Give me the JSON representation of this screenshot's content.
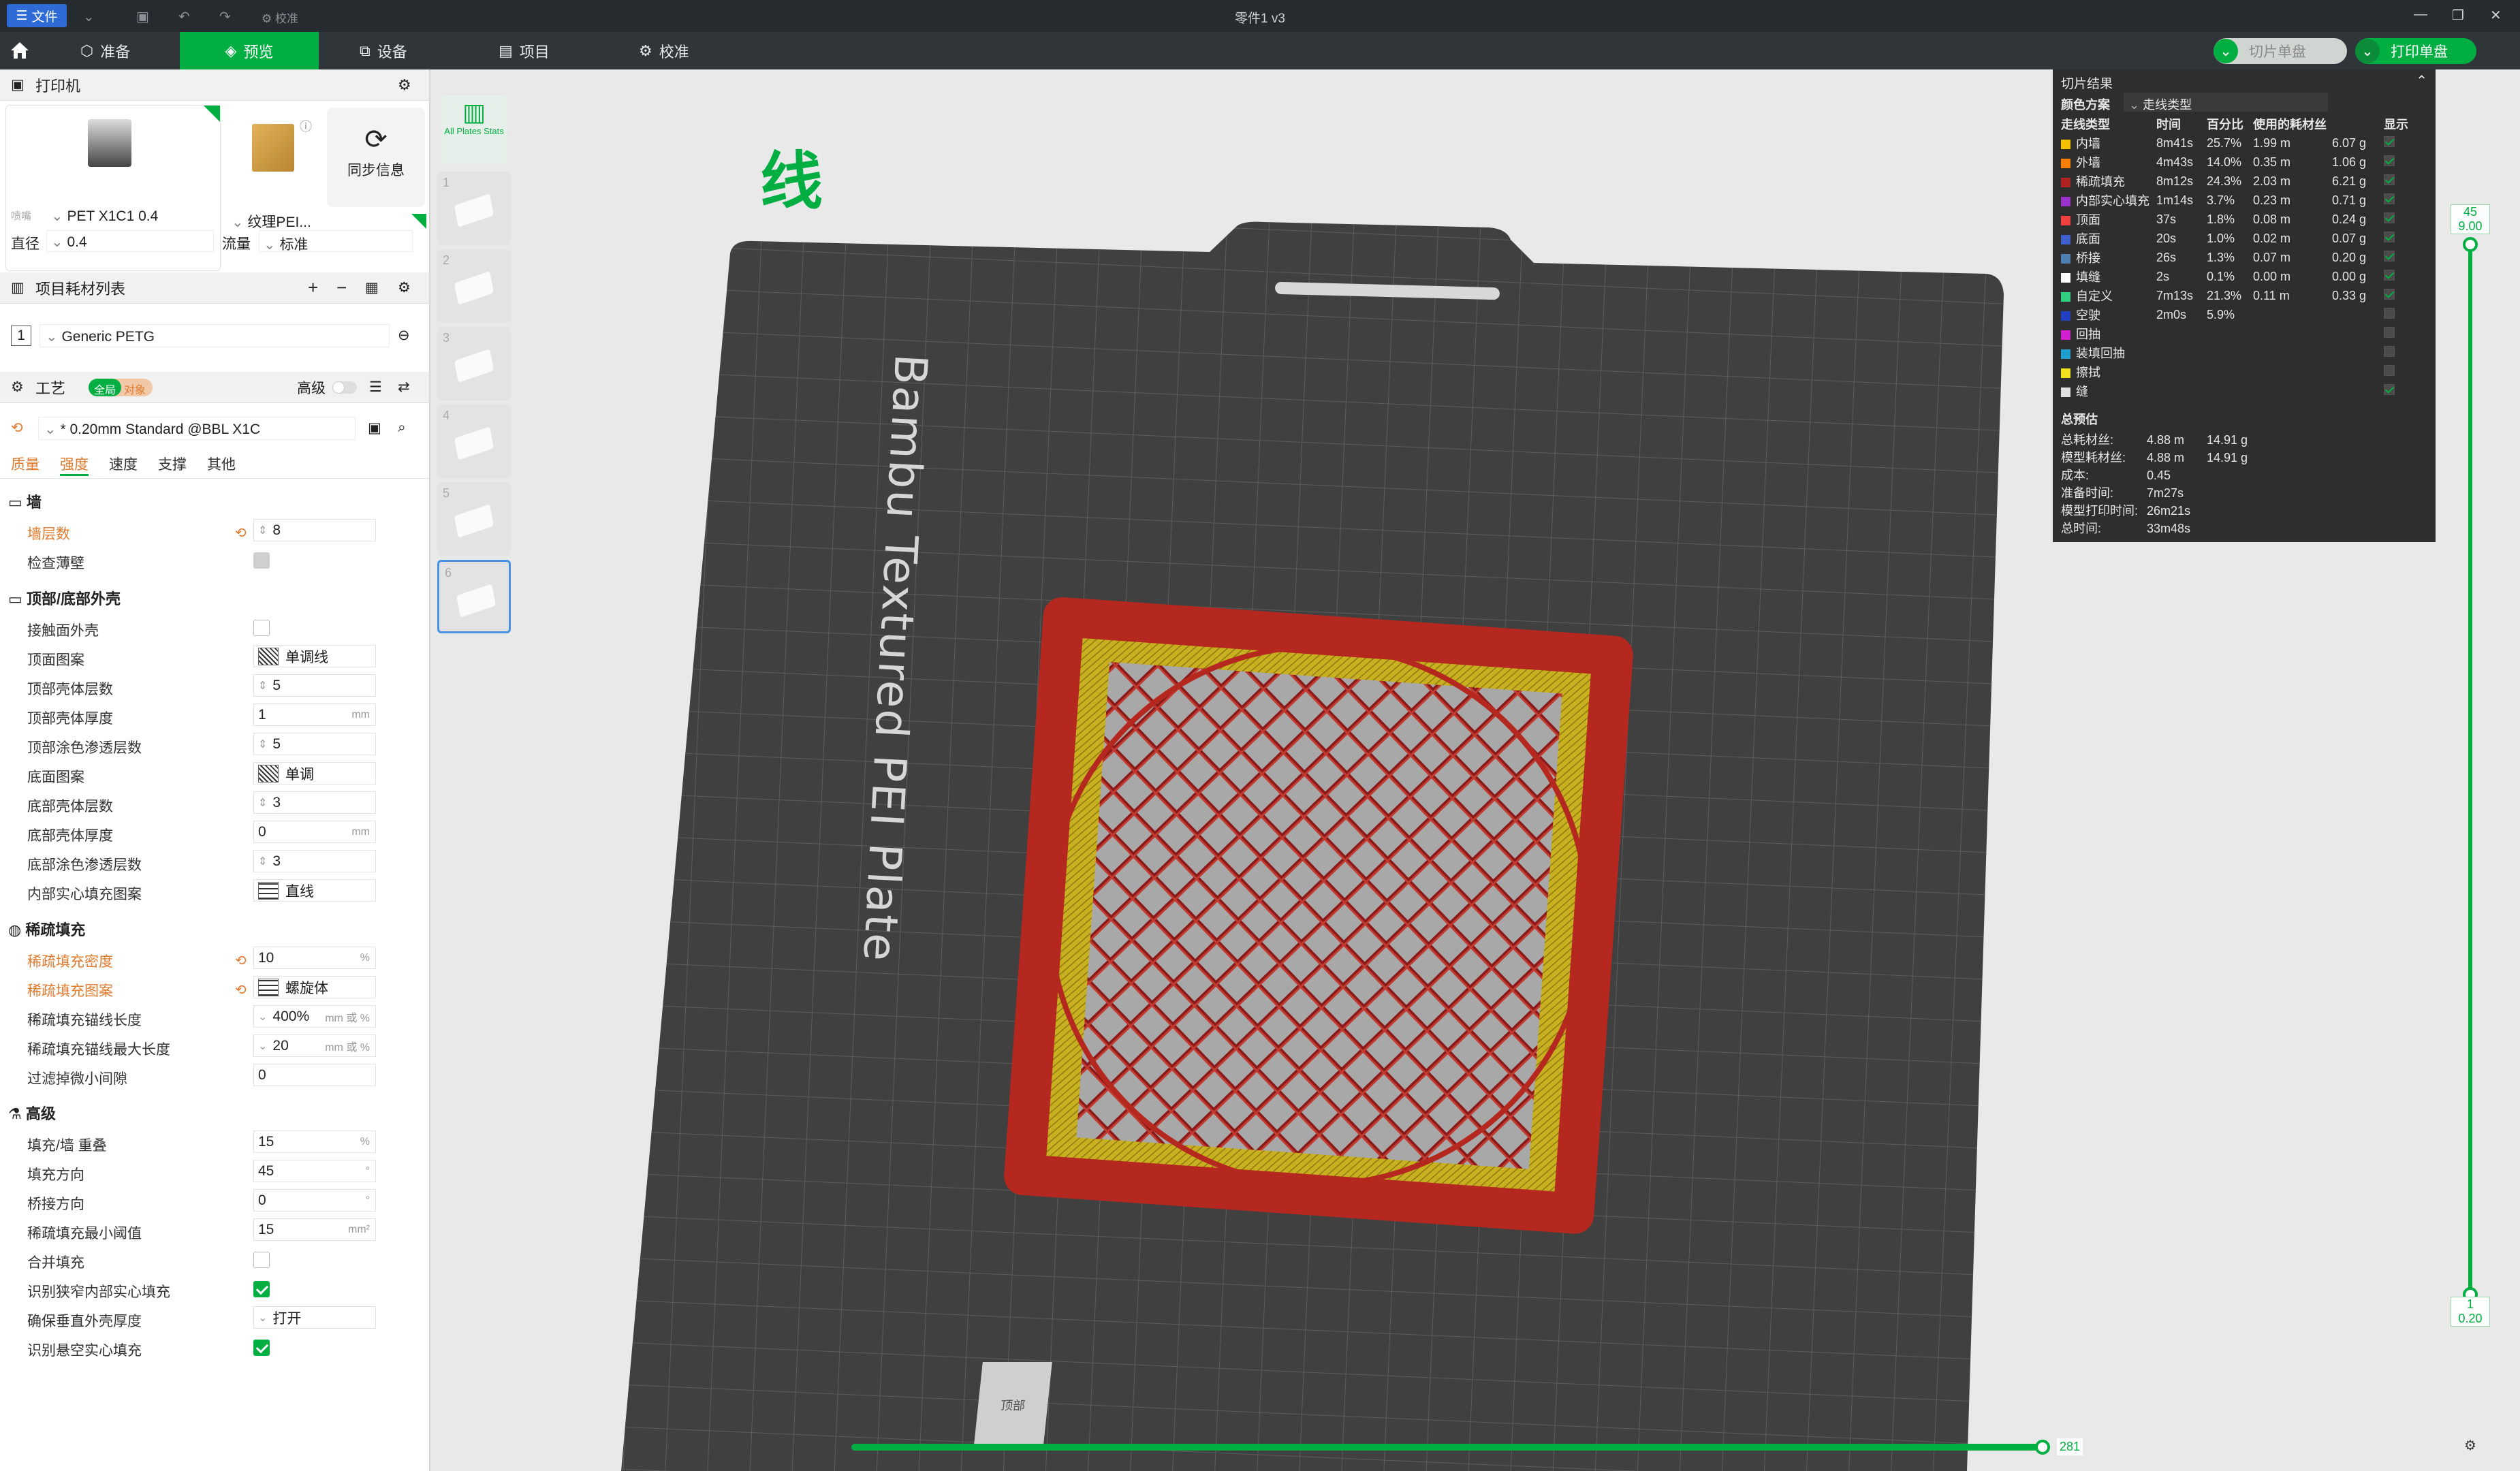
{
  "titlebar": {
    "file_menu": "文件",
    "verify": "校准",
    "title": "零件1 v3"
  },
  "tabs": [
    {
      "label": "准备"
    },
    {
      "label": "预览"
    },
    {
      "label": "设备"
    },
    {
      "label": "项目"
    },
    {
      "label": "校准"
    }
  ],
  "toolbar": {
    "slice_label": "切片单盘",
    "print_label": "打印单盘"
  },
  "printer": {
    "section": "打印机",
    "name": "PET X1C1 0.4",
    "plate": "纹理PEI...",
    "sync": "同步信息",
    "nozzle_group": "喷嘴",
    "diameter_label": "直径",
    "diameter": "0.4",
    "flow_label": "流量",
    "flow": "标准"
  },
  "filament": {
    "section": "项目耗材列表",
    "index": "1",
    "name": "Generic PETG"
  },
  "process": {
    "section": "工艺",
    "toggle_global": "全局",
    "toggle_object": "对象",
    "advanced": "高级",
    "preset": "* 0.20mm Standard @BBL X1C",
    "tabs": [
      "质量",
      "强度",
      "速度",
      "支撑",
      "其他"
    ]
  },
  "groups": {
    "wall": "墙",
    "topbottom": "顶部/底部外壳",
    "infill": "稀疏填充",
    "advanced": "高级"
  },
  "settings": {
    "wall_loops": {
      "label": "墙层数",
      "value": "8"
    },
    "detect_thin": {
      "label": "检查薄壁"
    },
    "interface_shells": {
      "label": "接触面外壳"
    },
    "top_pattern": {
      "label": "顶面图案",
      "value": "单调线"
    },
    "top_layers": {
      "label": "顶部壳体层数",
      "value": "5"
    },
    "top_thickness": {
      "label": "顶部壳体厚度",
      "value": "1",
      "unit": "mm"
    },
    "top_paint": {
      "label": "顶部涂色渗透层数",
      "value": "5"
    },
    "bottom_pattern": {
      "label": "底面图案",
      "value": "单调"
    },
    "bottom_layers": {
      "label": "底部壳体层数",
      "value": "3"
    },
    "bottom_thickness": {
      "label": "底部壳体厚度",
      "value": "0",
      "unit": "mm"
    },
    "bottom_paint": {
      "label": "底部涂色渗透层数",
      "value": "3"
    },
    "internal_pattern": {
      "label": "内部实心填充图案",
      "value": "直线"
    },
    "infill_density": {
      "label": "稀疏填充密度",
      "value": "10",
      "unit": "%"
    },
    "infill_pattern": {
      "label": "稀疏填充图案",
      "value": "螺旋体"
    },
    "anchor_len": {
      "label": "稀疏填充锚线长度",
      "value": "400%",
      "unit": "mm 或 %"
    },
    "anchor_max": {
      "label": "稀疏填充锚线最大长度",
      "value": "20",
      "unit": "mm 或 %"
    },
    "filter_gap": {
      "label": "过滤掉微小间隙",
      "value": "0"
    },
    "overlap": {
      "label": "填充/墙 重叠",
      "value": "15",
      "unit": "%"
    },
    "infill_dir": {
      "label": "填充方向",
      "value": "45",
      "unit": "°"
    },
    "bridge_dir": {
      "label": "桥接方向",
      "value": "0",
      "unit": "°"
    },
    "min_area": {
      "label": "稀疏填充最小阈值",
      "value": "15",
      "unit": "mm²"
    },
    "combine": {
      "label": "合并填充"
    },
    "detect_narrow": {
      "label": "识别狭窄内部实心填充"
    },
    "ensure_vertical": {
      "label": "确保垂直外壳厚度",
      "value": "打开"
    },
    "overhang_solid": {
      "label": "识别悬空实心填充"
    }
  },
  "plates": {
    "all_label": "All Plates Stats",
    "items": [
      "1",
      "2",
      "3",
      "4",
      "5",
      "6"
    ]
  },
  "viewport": {
    "legend_title": "线",
    "bed_text": "Bambu Textured PEI Plate",
    "view_cube": "顶部",
    "vslider": {
      "top_layer": "45",
      "top_height": "9.00",
      "bottom_layer": "1",
      "bottom_height": "0.20"
    },
    "hslider_value": "281"
  },
  "result": {
    "title": "切片结果",
    "scheme_label": "颜色方案",
    "scheme": "走线类型",
    "headers": [
      "走线类型",
      "时间",
      "百分比",
      "使用的耗材丝",
      "",
      "显示"
    ],
    "rows": [
      {
        "name": "内墙",
        "color": "#f5c000",
        "time": "8m41s",
        "pct": "25.7%",
        "len": "1.99 m",
        "g": "6.07 g",
        "show": true
      },
      {
        "name": "外墙",
        "color": "#ff8000",
        "time": "4m43s",
        "pct": "14.0%",
        "len": "0.35 m",
        "g": "1.06 g",
        "show": true
      },
      {
        "name": "稀疏填充",
        "color": "#b22222",
        "time": "8m12s",
        "pct": "24.3%",
        "len": "2.03 m",
        "g": "6.21 g",
        "show": true
      },
      {
        "name": "内部实心填充",
        "color": "#9933cc",
        "time": "1m14s",
        "pct": "3.7%",
        "len": "0.23 m",
        "g": "0.71 g",
        "show": true
      },
      {
        "name": "顶面",
        "color": "#f04040",
        "time": "37s",
        "pct": "1.8%",
        "len": "0.08 m",
        "g": "0.24 g",
        "show": true
      },
      {
        "name": "底面",
        "color": "#4060d0",
        "time": "20s",
        "pct": "1.0%",
        "len": "0.02 m",
        "g": "0.07 g",
        "show": true
      },
      {
        "name": "桥接",
        "color": "#5080b0",
        "time": "26s",
        "pct": "1.3%",
        "len": "0.07 m",
        "g": "0.20 g",
        "show": true
      },
      {
        "name": "填缝",
        "color": "#ffffff",
        "time": "2s",
        "pct": "0.1%",
        "len": "0.00 m",
        "g": "0.00 g",
        "show": true
      },
      {
        "name": "自定义",
        "color": "#30d080",
        "time": "7m13s",
        "pct": "21.3%",
        "len": "0.11 m",
        "g": "0.33 g",
        "show": true
      },
      {
        "name": "空驶",
        "color": "#2040c0",
        "time": "2m0s",
        "pct": "5.9%",
        "len": "",
        "g": "",
        "show": false
      },
      {
        "name": "回抽",
        "color": "#d020d0",
        "time": "",
        "pct": "",
        "len": "",
        "g": "",
        "show": false
      },
      {
        "name": "装填回抽",
        "color": "#20a0d0",
        "time": "",
        "pct": "",
        "len": "",
        "g": "",
        "show": false
      },
      {
        "name": "擦拭",
        "color": "#f0e020",
        "time": "",
        "pct": "",
        "len": "",
        "g": "",
        "show": false
      },
      {
        "name": "缝",
        "color": "#e0e0e0",
        "time": "",
        "pct": "",
        "len": "",
        "g": "",
        "show": true
      }
    ],
    "estimate_title": "总预估",
    "estimates": [
      {
        "k": "总耗材丝:",
        "a": "4.88 m",
        "b": "14.91 g"
      },
      {
        "k": "模型耗材丝:",
        "a": "4.88 m",
        "b": "14.91 g"
      },
      {
        "k": "成本:",
        "a": "0.45",
        "b": ""
      },
      {
        "k": "准备时间:",
        "a": "7m27s",
        "b": ""
      },
      {
        "k": "模型打印时间:",
        "a": "26m21s",
        "b": ""
      },
      {
        "k": "总时间:",
        "a": "33m48s",
        "b": ""
      }
    ]
  }
}
